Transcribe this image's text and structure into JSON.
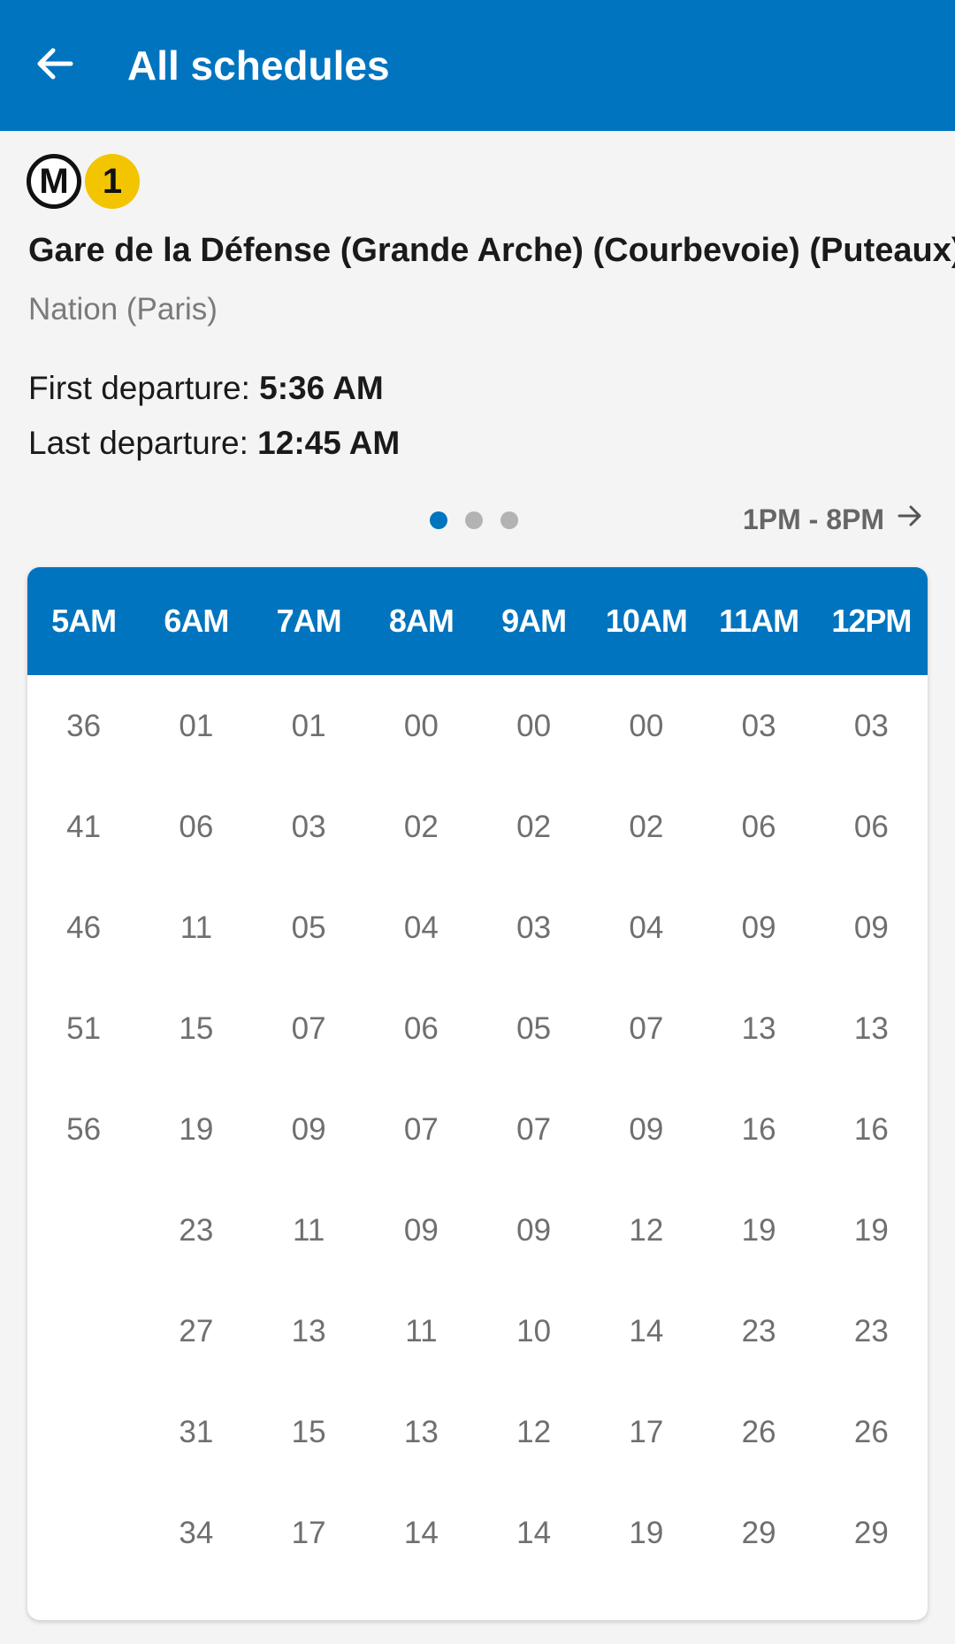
{
  "header": {
    "title": "All schedules",
    "back_icon": "arrow-left-icon"
  },
  "line": {
    "mode_badge": "M",
    "number": "1",
    "line_color": "#f2c500"
  },
  "station": "Gare de la Défense (Grande Arche) (Courbevoie) (Puteaux)",
  "direction": "Nation (Paris)",
  "first_departure": {
    "label": "First departure:",
    "value": "5:36 AM"
  },
  "last_departure": {
    "label": "Last departure:",
    "value": "12:45 AM"
  },
  "pager": {
    "pages": 3,
    "active": 0
  },
  "next_range": {
    "label": "1PM - 8PM",
    "icon": "arrow-right-icon"
  },
  "schedule": {
    "hours": [
      "5AM",
      "6AM",
      "7AM",
      "8AM",
      "9AM",
      "10AM",
      "11AM",
      "12PM"
    ],
    "minutes": [
      [
        "36",
        "41",
        "46",
        "51",
        "56"
      ],
      [
        "01",
        "06",
        "11",
        "15",
        "19",
        "23",
        "27",
        "31",
        "34"
      ],
      [
        "01",
        "03",
        "05",
        "07",
        "09",
        "11",
        "13",
        "15",
        "17"
      ],
      [
        "00",
        "02",
        "04",
        "06",
        "07",
        "09",
        "11",
        "13",
        "14"
      ],
      [
        "00",
        "02",
        "03",
        "05",
        "07",
        "09",
        "10",
        "12",
        "14"
      ],
      [
        "00",
        "02",
        "04",
        "07",
        "09",
        "12",
        "14",
        "17",
        "19"
      ],
      [
        "03",
        "06",
        "09",
        "13",
        "16",
        "19",
        "23",
        "26",
        "29"
      ],
      [
        "03",
        "06",
        "09",
        "13",
        "16",
        "19",
        "23",
        "26",
        "29"
      ]
    ]
  },
  "colors": {
    "primary": "#0074be",
    "background": "#f4f4f4"
  }
}
